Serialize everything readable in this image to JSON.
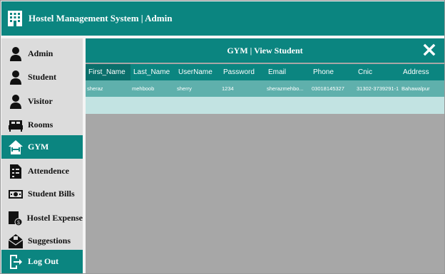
{
  "app": {
    "title": "Hostel Management System | Admin"
  },
  "sidebar": {
    "items": [
      {
        "label": "Admin",
        "icon": "admin-user-icon"
      },
      {
        "label": "Student",
        "icon": "student-user-icon"
      },
      {
        "label": "Visitor",
        "icon": "visitor-user-icon"
      },
      {
        "label": "Rooms",
        "icon": "bed-icon"
      },
      {
        "label": "GYM",
        "icon": "dumbbell-icon"
      },
      {
        "label": "Attendence",
        "icon": "attendance-sheet-icon"
      },
      {
        "label": "Student Bills",
        "icon": "cash-bill-icon"
      },
      {
        "label": "Hostel Expense",
        "icon": "expense-icon"
      },
      {
        "label": "Suggestions",
        "icon": "mail-envelope-icon"
      },
      {
        "label": "Log Out",
        "icon": "logout-icon"
      }
    ],
    "active": "GYM"
  },
  "panel": {
    "title": "GYM | View Student"
  },
  "table": {
    "columns": [
      "First_Name",
      "Last_Name",
      "UserName",
      "Password",
      "Email",
      "Phone",
      "Cnic",
      "Address"
    ],
    "rows": [
      [
        "sheraz",
        "mehboob",
        "sherry",
        "1234",
        "sherazmehbo...",
        "03018145327",
        "31302-3739291-1",
        "Bahawalpur"
      ]
    ]
  },
  "colors": {
    "accent": "#0b8580",
    "row": "#5fb0ac",
    "empty_row": "#c2e3e2",
    "grid_bg": "#a7a7a7"
  }
}
